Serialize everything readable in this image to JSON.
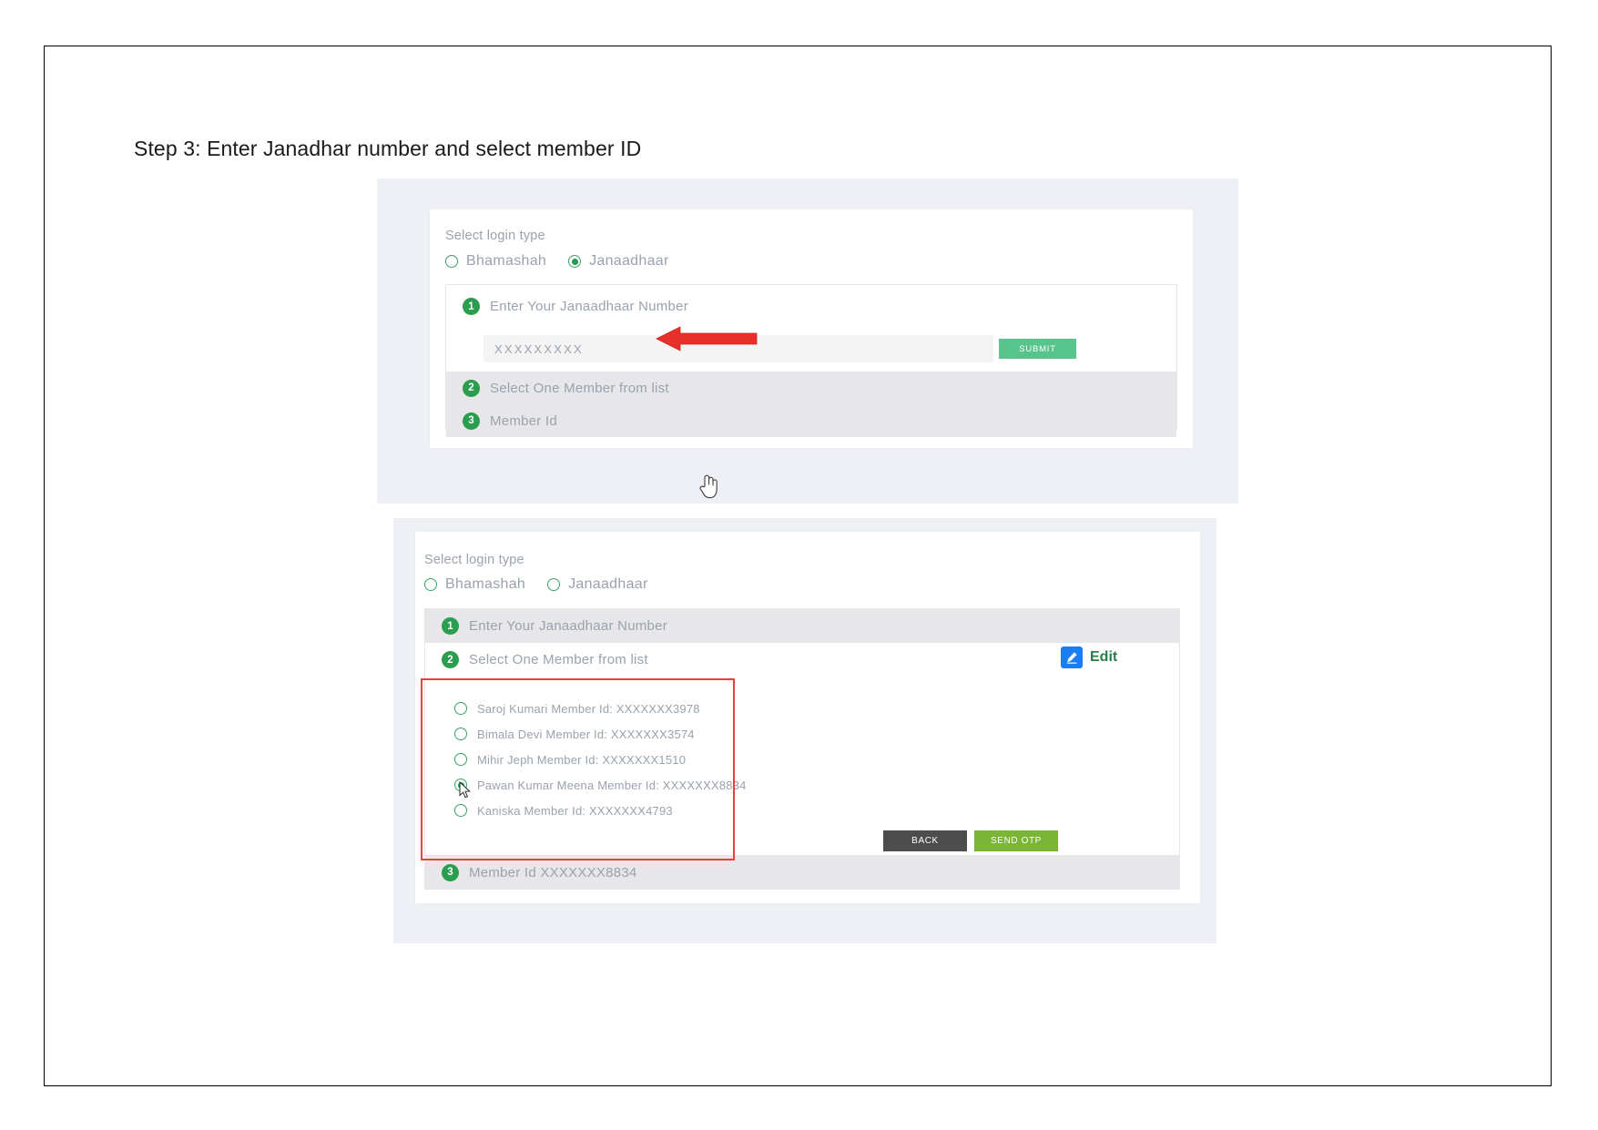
{
  "heading": "Step 3: Enter Janadhar number and select member ID",
  "panel1": {
    "select_login_label": "Select login type",
    "login_types": [
      {
        "label": "Bhamashah",
        "selected": false
      },
      {
        "label": "Janaadhaar",
        "selected": true
      }
    ],
    "steps": [
      {
        "number": "1",
        "label": "Enter Your Janaadhaar Number"
      },
      {
        "number": "2",
        "label": "Select One Member from list"
      },
      {
        "number": "3",
        "label": "Member Id"
      }
    ],
    "input": {
      "value": "",
      "placeholder": "XXXXXXXXX"
    },
    "submit_label": "SUBMIT",
    "annotation_icon": "red-left-arrow",
    "cursor_icon": "pointing-hand-cursor"
  },
  "panel2": {
    "select_login_label": "Select login type",
    "login_types": [
      {
        "label": "Bhamashah",
        "selected": false
      },
      {
        "label": "Janaadhaar",
        "selected": false
      }
    ],
    "steps": [
      {
        "number": "1",
        "label": "Enter Your Janaadhaar Number"
      },
      {
        "number": "2",
        "label": "Select One Member from list"
      },
      {
        "number": "3",
        "label": "Member Id XXXXXXX8834"
      }
    ],
    "edit": {
      "label": "Edit",
      "icon": "pencil-square-icon",
      "icon_color": "#1a7ef0",
      "text_color": "#2a7d4b"
    },
    "members": [
      {
        "label": "Saroj Kumari Member Id: XXXXXXX3978",
        "selected": false
      },
      {
        "label": "Bimala Devi Member Id: XXXXXXX3574",
        "selected": false
      },
      {
        "label": "Mihir Jeph Member Id: XXXXXXX1510",
        "selected": false
      },
      {
        "label": "Pawan Kumar Meena Member Id: XXXXXXX8834",
        "selected": true
      },
      {
        "label": "Kaniska Member Id: XXXXXXX4793",
        "selected": false
      }
    ],
    "back_label": "BACK",
    "send_otp_label": "SEND OTP",
    "highlight_color": "#e8403a",
    "cursor_icon": "arrow-cursor"
  },
  "colors": {
    "step_badge_green": "#2a9d4e",
    "submit_green": "#57c48c",
    "send_otp_green": "#7ab535",
    "back_grey": "#4d4d4d",
    "annotation_red": "#e8403a",
    "panel_bg": "#eef0f5",
    "muted_text": "#9aa2ad"
  }
}
